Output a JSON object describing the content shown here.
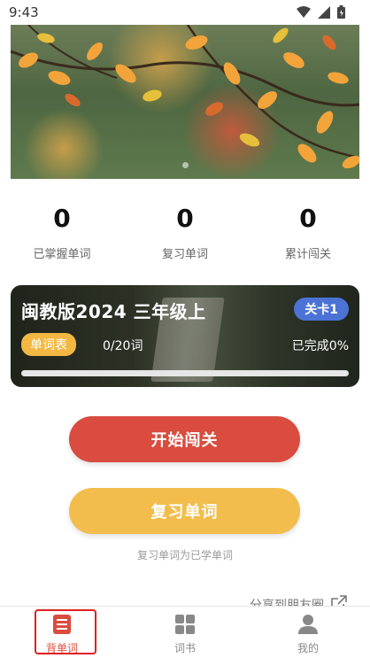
{
  "status_bar": {
    "time": "9:43"
  },
  "banner": {
    "slides": 3,
    "active_slide": 1
  },
  "stats": [
    {
      "value": "0",
      "label": "已掌握单词"
    },
    {
      "value": "0",
      "label": "复习单词"
    },
    {
      "value": "0",
      "label": "累计闯关"
    }
  ],
  "course_card": {
    "title": "闽教版2024 三年级上",
    "level_badge": "关卡1",
    "wordlist_tag": "单词表",
    "word_progress": "0/20词",
    "completion": "已完成0%",
    "progress_fraction": 0
  },
  "buttons": {
    "start": "开始闯关",
    "review": "复习单词"
  },
  "review_hint": "复习单词为已学单词",
  "share_label": "分享到朋友圈",
  "bottom_nav": [
    {
      "label": "背单词",
      "icon": "memorize-icon",
      "active": true
    },
    {
      "label": "词书",
      "icon": "grid-icon",
      "active": false
    },
    {
      "label": "我的",
      "icon": "user-icon",
      "active": false
    }
  ],
  "colors": {
    "start_button": "#d94c3f",
    "review_button": "#f2bd4c",
    "level_badge": "#4b73d6",
    "active_nav": "#d94c3f",
    "inactive_nav": "#888888"
  }
}
